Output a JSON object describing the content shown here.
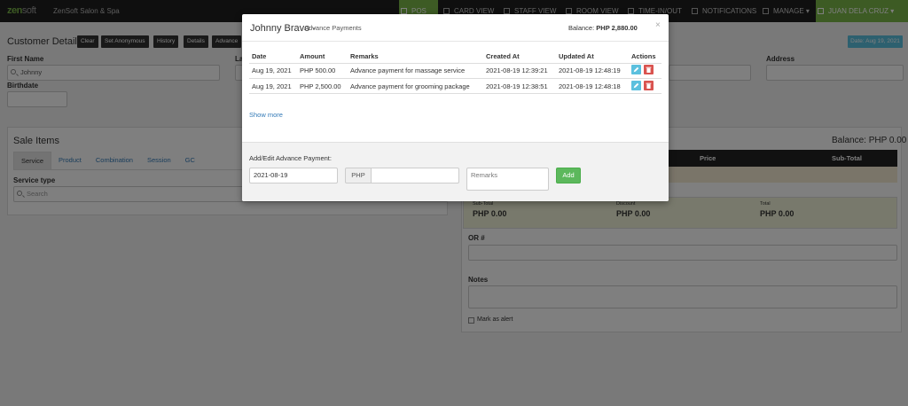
{
  "app": {
    "logo_a": "zen",
    "logo_b": "soft",
    "brand": "ZenSoft Salon & Spa"
  },
  "nav": {
    "pos": "POS",
    "card_view": "CARD VIEW",
    "staff_view": "STAFF VIEW",
    "room_view": "ROOM VIEW",
    "time_in_out": "TIME-IN/OUT",
    "notifications": "NOTIFICATIONS",
    "manage": "MANAGE ▾",
    "user": "JUAN DELA CRUZ ▾"
  },
  "customer": {
    "title": "Customer Details",
    "buttons": {
      "clear": "Clear",
      "anonymous": "Set Anonymous",
      "history": "History",
      "details": "Details",
      "advance": "Advance"
    },
    "date_badge": "Date: Aug 19, 2021",
    "first_name_label": "First Name",
    "first_name_value": "Johnny",
    "last_name_label": "La",
    "birthdate_label": "Birthdate",
    "address_label": "Address"
  },
  "sale": {
    "title": "Sale Items",
    "tabs": [
      "Service",
      "Product",
      "Combination",
      "Session",
      "GC"
    ],
    "service_type_label": "Service type",
    "search_placeholder": "Search"
  },
  "right": {
    "balance": "Balance: PHP 0.00",
    "col_price": "Price",
    "col_subtotal": "Sub-Total",
    "totals": [
      {
        "label": "Sub-Total",
        "value": "PHP 0.00"
      },
      {
        "label": "Discount",
        "value": "PHP 0.00"
      },
      {
        "label": "Total",
        "value": "PHP 0.00"
      }
    ],
    "or_label": "OR #",
    "notes_label": "Notes",
    "alert_label": "Mark as alert"
  },
  "modal": {
    "title": "Johnny Bravo - ",
    "subtitle": "Advance Payments",
    "balance_label": "Balance: ",
    "balance_value": "PHP 2,880.00",
    "close": "×",
    "columns": [
      "Date",
      "Amount",
      "Remarks",
      "Created At",
      "Updated At",
      "Actions"
    ],
    "rows": [
      {
        "date": "Aug 19, 2021",
        "amount": "PHP 500.00",
        "remarks": "Advance payment for massage service",
        "created": "2021-08-19 12:39:21",
        "updated": "2021-08-19 12:48:19"
      },
      {
        "date": "Aug 19, 2021",
        "amount": "PHP 2,500.00",
        "remarks": "Advance payment for grooming package",
        "created": "2021-08-19 12:38:51",
        "updated": "2021-08-19 12:48:18"
      }
    ],
    "show_more": "Show more",
    "form": {
      "label": "Add/Edit Advance Payment:",
      "date_value": "2021-08-19",
      "currency": "PHP",
      "amount_value": "",
      "remarks_placeholder": "Remarks",
      "add_label": "Add"
    }
  },
  "colors": {
    "green": "#7ab648",
    "blue": "#5bc0de",
    "red": "#d9534f",
    "add": "#5cb85c"
  }
}
